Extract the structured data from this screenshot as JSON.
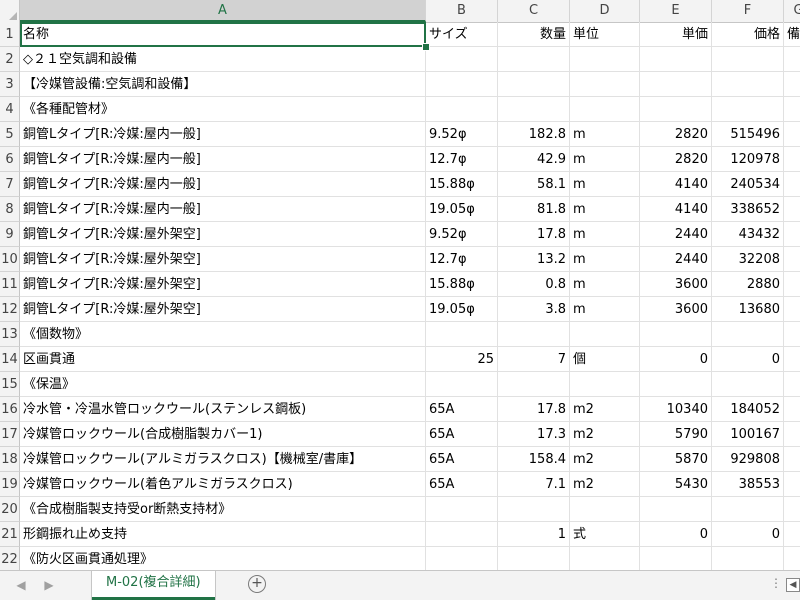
{
  "columns": [
    "A",
    "B",
    "C",
    "D",
    "E",
    "F",
    "G"
  ],
  "rows": [
    {
      "n": "1",
      "a": "名称",
      "b": "サイズ",
      "c": "数量",
      "d": "単位",
      "e": "単価",
      "f": "価格",
      "g": "備"
    },
    {
      "n": "2",
      "a": "◇２１空気調和設備",
      "b": "",
      "c": "",
      "d": "",
      "e": "",
      "f": "",
      "g": ""
    },
    {
      "n": "3",
      "a": "【冷媒管設備:空気調和設備】",
      "b": "",
      "c": "",
      "d": "",
      "e": "",
      "f": "",
      "g": ""
    },
    {
      "n": "4",
      "a": "《各種配管材》",
      "b": "",
      "c": "",
      "d": "",
      "e": "",
      "f": "",
      "g": ""
    },
    {
      "n": "5",
      "a": "銅管Lタイプ[R:冷媒:屋内一般]",
      "b": "9.52φ",
      "c": "182.8",
      "d": "m",
      "e": "2820",
      "f": "515496",
      "g": ""
    },
    {
      "n": "6",
      "a": "銅管Lタイプ[R:冷媒:屋内一般]",
      "b": "12.7φ",
      "c": "42.9",
      "d": "m",
      "e": "2820",
      "f": "120978",
      "g": ""
    },
    {
      "n": "7",
      "a": "銅管Lタイプ[R:冷媒:屋内一般]",
      "b": "15.88φ",
      "c": "58.1",
      "d": "m",
      "e": "4140",
      "f": "240534",
      "g": ""
    },
    {
      "n": "8",
      "a": "銅管Lタイプ[R:冷媒:屋内一般]",
      "b": "19.05φ",
      "c": "81.8",
      "d": "m",
      "e": "4140",
      "f": "338652",
      "g": ""
    },
    {
      "n": "9",
      "a": "銅管Lタイプ[R:冷媒:屋外架空]",
      "b": "9.52φ",
      "c": "17.8",
      "d": "m",
      "e": "2440",
      "f": "43432",
      "g": ""
    },
    {
      "n": "10",
      "a": "銅管Lタイプ[R:冷媒:屋外架空]",
      "b": "12.7φ",
      "c": "13.2",
      "d": "m",
      "e": "2440",
      "f": "32208",
      "g": ""
    },
    {
      "n": "11",
      "a": "銅管Lタイプ[R:冷媒:屋外架空]",
      "b": "15.88φ",
      "c": "0.8",
      "d": "m",
      "e": "3600",
      "f": "2880",
      "g": ""
    },
    {
      "n": "12",
      "a": "銅管Lタイプ[R:冷媒:屋外架空]",
      "b": "19.05φ",
      "c": "3.8",
      "d": "m",
      "e": "3600",
      "f": "13680",
      "g": ""
    },
    {
      "n": "13",
      "a": "《個数物》",
      "b": "",
      "c": "",
      "d": "",
      "e": "",
      "f": "",
      "g": ""
    },
    {
      "n": "14",
      "a": "区画貫通",
      "b": "25",
      "c": "7",
      "d": "個",
      "e": "0",
      "f": "0",
      "g": ""
    },
    {
      "n": "15",
      "a": "《保温》",
      "b": "",
      "c": "",
      "d": "",
      "e": "",
      "f": "",
      "g": ""
    },
    {
      "n": "16",
      "a": "冷水管・冷温水管ロックウール(ステンレス鋼板)",
      "b": "65A",
      "c": "17.8",
      "d": "m2",
      "e": "10340",
      "f": "184052",
      "g": ""
    },
    {
      "n": "17",
      "a": "冷媒管ロックウール(合成樹脂製カバー1)",
      "b": "65A",
      "c": "17.3",
      "d": "m2",
      "e": "5790",
      "f": "100167",
      "g": ""
    },
    {
      "n": "18",
      "a": "冷媒管ロックウール(アルミガラスクロス)【機械室/書庫】",
      "b": "65A",
      "c": "158.4",
      "d": "m2",
      "e": "5870",
      "f": "929808",
      "g": ""
    },
    {
      "n": "19",
      "a": "冷媒管ロックウール(着色アルミガラスクロス)",
      "b": "65A",
      "c": "7.1",
      "d": "m2",
      "e": "5430",
      "f": "38553",
      "g": ""
    },
    {
      "n": "20",
      "a": "《合成樹脂製支持受or断熱支持材》",
      "b": "",
      "c": "",
      "d": "",
      "e": "",
      "f": "",
      "g": ""
    },
    {
      "n": "21",
      "a": "形鋼振れ止め支持",
      "b": "",
      "c": "1",
      "d": "式",
      "e": "0",
      "f": "0",
      "g": ""
    },
    {
      "n": "22",
      "a": "《防火区画貫通処理》",
      "b": "",
      "c": "",
      "d": "",
      "e": "",
      "f": "",
      "g": ""
    }
  ],
  "sheet_tab": {
    "label": "M-02(複合詳細)"
  },
  "add_sheet_icon": "+",
  "nav_prev": "◀",
  "nav_next": "▶",
  "more_dots": "⋮",
  "scroll_left": "◀",
  "accent_color": "#217346"
}
